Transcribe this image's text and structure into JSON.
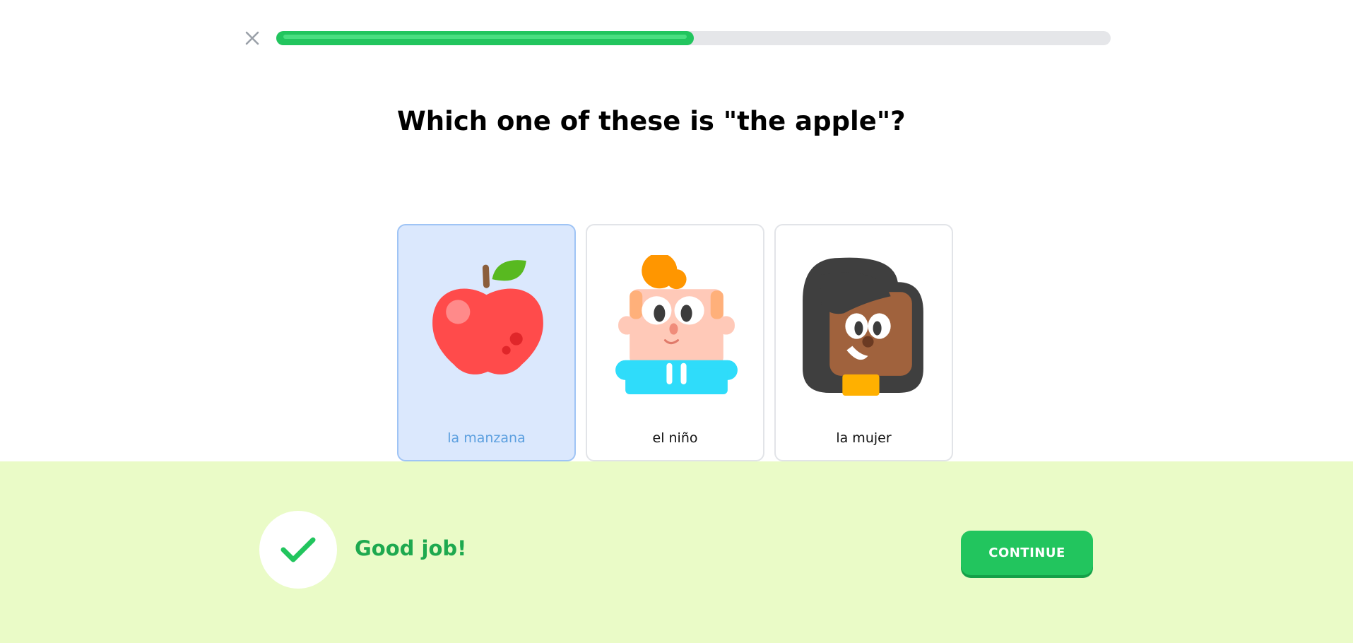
{
  "header": {
    "close_icon": "close-icon",
    "progress": 0.5
  },
  "question": {
    "text": "Which one of these is \"the apple\"?"
  },
  "choices": [
    {
      "label": "la manzana",
      "icon": "apple-illustration",
      "selected": true
    },
    {
      "label": "el niño",
      "icon": "boy-illustration",
      "selected": false
    },
    {
      "label": "la mujer",
      "icon": "woman-illustration",
      "selected": false
    }
  ],
  "feedback": {
    "icon": "checkmark-icon",
    "message": "Good job!",
    "continue_label": "CONTINUE"
  },
  "colors": {
    "accent_green": "#22c55e",
    "footer_bg": "#eafbc7",
    "selected_bg": "#dbe8fd",
    "selected_label": "#5b9fdf",
    "feedback_text": "#1ea94f"
  }
}
